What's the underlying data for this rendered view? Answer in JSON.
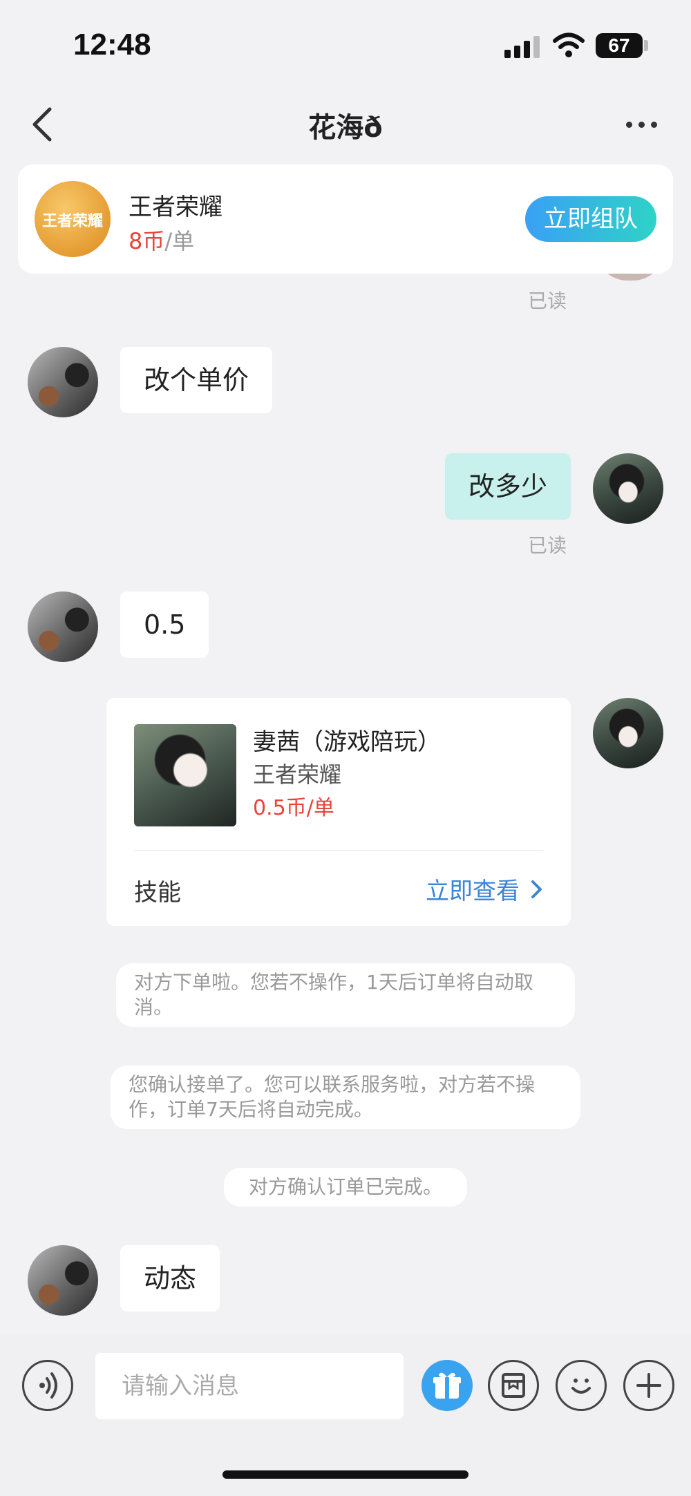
{
  "status": {
    "time": "12:48",
    "battery": "67"
  },
  "header": {
    "title": "花海ð"
  },
  "game_card": {
    "name": "王者荣耀",
    "price_value": "8币",
    "price_unit": "/单",
    "cta": "立即组队",
    "logo_text": "王者荣耀"
  },
  "messages": {
    "read1": "已读",
    "m1": "改个单价",
    "m2": "改多少",
    "read2": "已读",
    "m3": "0.5",
    "m4": "动态"
  },
  "product_card": {
    "title": "妻茜（游戏陪玩）",
    "game": "王者荣耀",
    "price": "0.5币/单",
    "skill": "技能",
    "view": "立即查看"
  },
  "system_notes": [
    "对方下单啦。您若不操作，1天后订单将自动取消。",
    "您确认接单了。您可以联系服务啦，对方若不操作，订单7天后将自动完成。",
    "对方确认订单已完成。"
  ],
  "input": {
    "placeholder": "请输入消息"
  },
  "icons": [
    "back-icon",
    "more-icon",
    "voice-icon",
    "gift-icon",
    "order-icon",
    "emoji-icon",
    "plus-icon",
    "chevron-right-icon"
  ],
  "colors": {
    "accent_blue": "#3b84d8",
    "price_red": "#e8443a",
    "mine_bubble": "#c8f0ec",
    "cta_start": "#3aa0f5",
    "cta_end": "#2ed3c7"
  }
}
